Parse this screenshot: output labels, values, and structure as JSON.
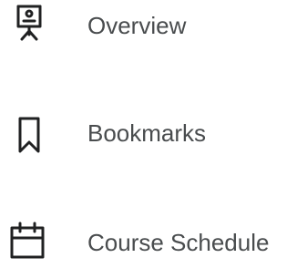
{
  "navigation": {
    "items": [
      {
        "label": "Overview",
        "icon": "presentation-board-icon"
      },
      {
        "label": "Bookmarks",
        "icon": "bookmark-icon"
      },
      {
        "label": "Course Schedule",
        "icon": "calendar-icon"
      }
    ]
  },
  "colors": {
    "text": "#494c4e",
    "icon": "#202122",
    "background": "#ffffff"
  }
}
